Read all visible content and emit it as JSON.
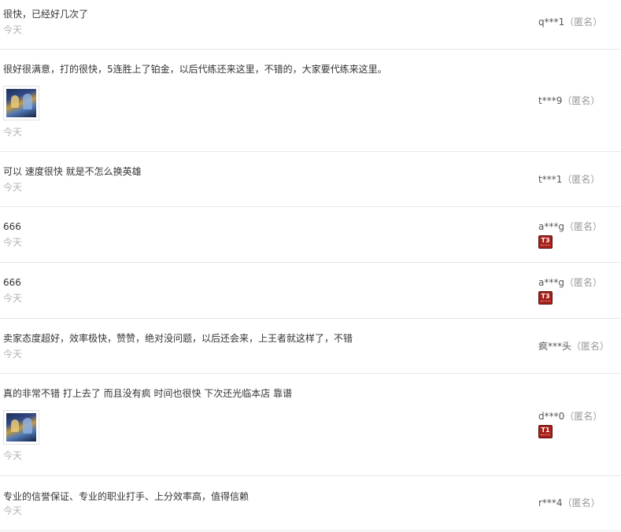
{
  "reviews": [
    {
      "text": "很快，已经好几次了",
      "date": "今天",
      "user": "q***1",
      "anon": "（匿名）"
    },
    {
      "text": "很好很满意，打的很快，5连胜上了铂金，以后代练还来这里，不错的，大家要代练来这里。",
      "date": "今天",
      "user": "t***9",
      "anon": "（匿名）"
    },
    {
      "text": "可以 速度很快 就是不怎么换英雄",
      "date": "今天",
      "user": "t***1",
      "anon": "（匿名）"
    },
    {
      "text": "666",
      "date": "今天",
      "user": "a***g",
      "anon": "（匿名）",
      "badge": "T3"
    },
    {
      "text": "666",
      "date": "今天",
      "user": "a***g",
      "anon": "（匿名）",
      "badge": "T3"
    },
    {
      "text": "卖家态度超好，效率极快，赞赞，绝对没问题，以后还会来，上王者就这样了，不错",
      "date": "今天",
      "user": "疯***头",
      "anon": "（匿名）"
    },
    {
      "text": "真的非常不错 打上去了 而且没有疯 时间也很快 下次还光临本店 靠谱",
      "date": "今天",
      "user": "d***0",
      "anon": "（匿名）",
      "badge": "T1"
    },
    {
      "text": "专业的信誉保证、专业的职业打手、上分效率高，值得信赖",
      "date": "今天",
      "user": "r***4",
      "anon": "（匿名）"
    }
  ]
}
